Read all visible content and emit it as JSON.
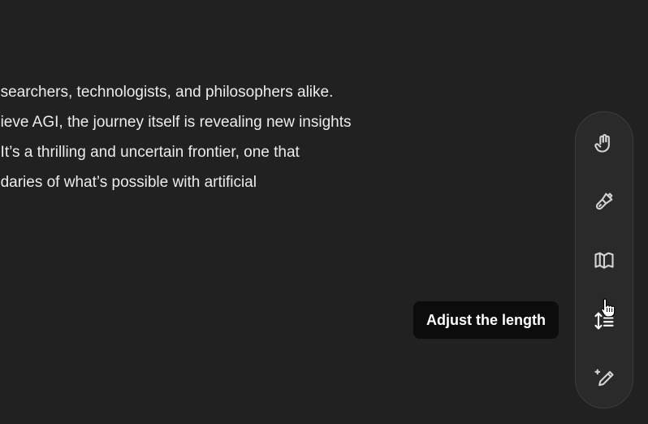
{
  "document": {
    "lines": [
      "esearchers, technologists, and philosophers alike.",
      "hieve AGI, the journey itself is revealing new insights",
      ". It’s a thrilling and uncertain frontier, one that",
      "ndaries of what’s possible with artificial"
    ]
  },
  "toolbar": {
    "tools": [
      {
        "icon": "hand-icon"
      },
      {
        "icon": "paintbrush-icon"
      },
      {
        "icon": "book-icon"
      },
      {
        "icon": "adjust-length-icon",
        "active": true
      },
      {
        "icon": "pencil-sparkle-icon"
      }
    ],
    "tooltip": "Adjust the length"
  },
  "colors": {
    "background": "#212121",
    "text": "#ececec",
    "toolbar_bg": "#2a2a2a",
    "tooltip_bg": "#0c0c0c"
  }
}
